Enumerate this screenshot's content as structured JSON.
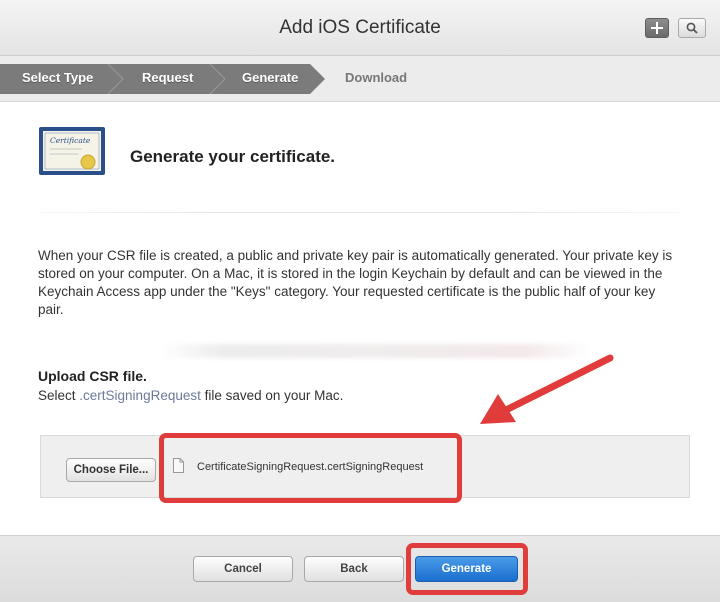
{
  "window": {
    "title": "Add iOS Certificate"
  },
  "toolbar_icons": {
    "add": "plus-icon",
    "search": "search-icon"
  },
  "steps": [
    {
      "label": "Select Type",
      "state": "done"
    },
    {
      "label": "Request",
      "state": "done"
    },
    {
      "label": "Generate",
      "state": "current"
    },
    {
      "label": "Download",
      "state": "upcoming"
    }
  ],
  "header": {
    "icon_text": "Certificate",
    "heading": "Generate your certificate."
  },
  "description": "When your CSR file is created, a public and private key pair is automatically generated. Your private key is stored on your computer. On a Mac, it is stored in the login Keychain by default and can be viewed in the Keychain Access app under the \"Keys\" category. Your requested certificate is the public half of your key pair.",
  "upload": {
    "title": "Upload CSR file.",
    "sub_prefix": "Select ",
    "sub_code": ".certSigningRequest",
    "sub_suffix": " file saved on your Mac.",
    "choose_label": "Choose File...",
    "file_name": "CertificateSigningRequest.certSigningRequest"
  },
  "footer": {
    "cancel": "Cancel",
    "back": "Back",
    "generate": "Generate"
  },
  "colors": {
    "annotation_red": "#e03c3c",
    "primary_blue": "#1a6fd0",
    "step_active": "#7a7a7a"
  }
}
